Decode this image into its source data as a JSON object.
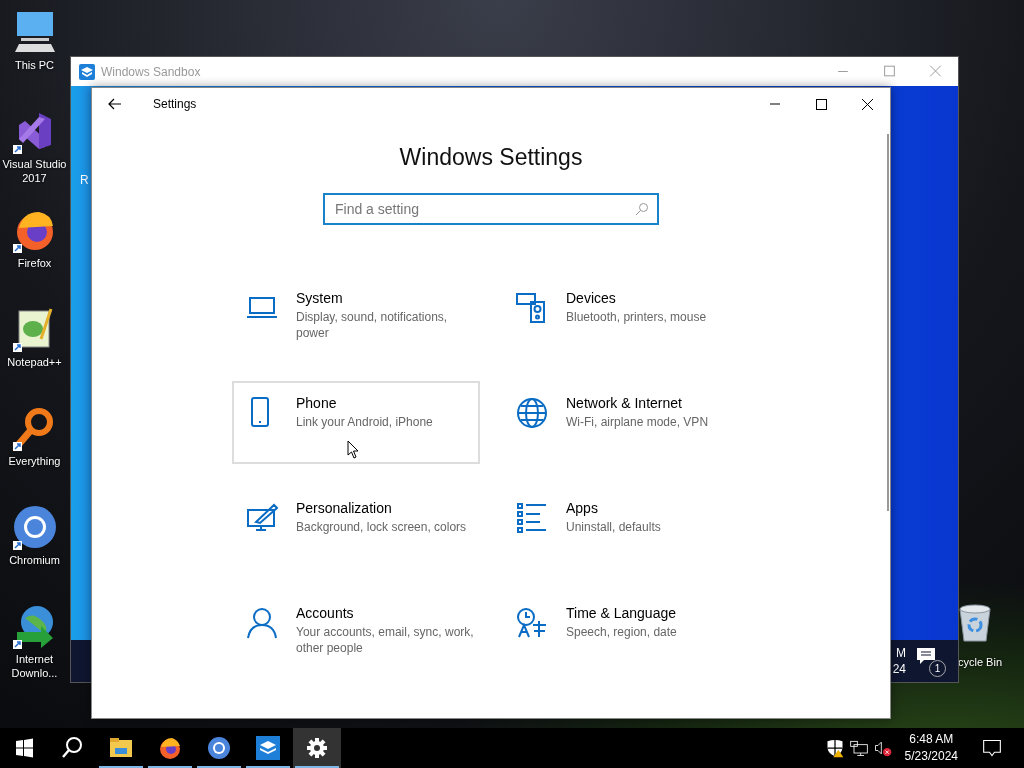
{
  "desktop_icons": [
    {
      "label": "This PC"
    },
    {
      "label": "Visual Studio 2017"
    },
    {
      "label": "Firefox"
    },
    {
      "label": "Notepad++"
    },
    {
      "label": "Everything"
    },
    {
      "label": "Chromium"
    },
    {
      "label": "Internet Downlo..."
    }
  ],
  "recycle_bin": {
    "label": "cycle Bin"
  },
  "sandbox_window": {
    "title": "Windows Sandbox",
    "active": false,
    "inner_text": "R",
    "inner_clock": [
      "M",
      "24"
    ],
    "notification_count": "1"
  },
  "settings_window": {
    "title": "Settings",
    "heading": "Windows Settings",
    "search": {
      "placeholder": "Find a setting"
    },
    "categories": [
      {
        "name": "System",
        "description": "Display, sound, notifications, power",
        "hovered": false
      },
      {
        "name": "Devices",
        "description": "Bluetooth, printers, mouse",
        "hovered": false
      },
      {
        "name": "Phone",
        "description": "Link your Android, iPhone",
        "hovered": true
      },
      {
        "name": "Network & Internet",
        "description": "Wi-Fi, airplane mode, VPN",
        "hovered": false
      },
      {
        "name": "Personalization",
        "description": "Background, lock screen, colors",
        "hovered": false
      },
      {
        "name": "Apps",
        "description": "Uninstall, defaults",
        "hovered": false
      },
      {
        "name": "Accounts",
        "description": "Your accounts, email, sync, work, other people",
        "hovered": false
      },
      {
        "name": "Time & Language",
        "description": "Speech, region, date",
        "hovered": false
      }
    ]
  },
  "taskbar": {
    "apps": [
      {
        "running": true,
        "selected": false
      },
      {
        "running": true,
        "selected": false
      },
      {
        "running": true,
        "selected": false
      },
      {
        "running": true,
        "selected": false
      },
      {
        "running": true,
        "selected": true
      }
    ],
    "clock": {
      "time": "6:48 AM",
      "date": "5/23/2024"
    }
  }
}
